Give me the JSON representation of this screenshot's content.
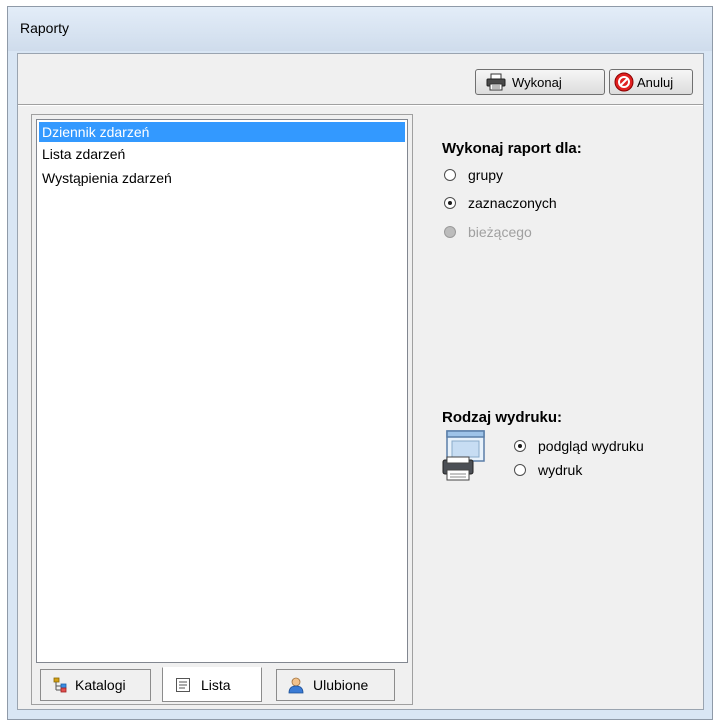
{
  "window": {
    "title": "Raporty"
  },
  "toolbar": {
    "execute_label": "Wykonaj",
    "cancel_label": "Anuluj"
  },
  "list": {
    "items": [
      {
        "label": "Dziennik zdarzeń",
        "selected": true
      },
      {
        "label": "Lista zdarzeń",
        "selected": false
      },
      {
        "label": "Wystąpienia zdarzeń",
        "selected": false
      }
    ]
  },
  "tabs": [
    {
      "label": "Katalogi",
      "icon": "catalog-tree-icon",
      "active": false
    },
    {
      "label": "Lista",
      "icon": "list-icon",
      "active": true
    },
    {
      "label": "Ulubione",
      "icon": "user-favorites-icon",
      "active": false
    }
  ],
  "report_target": {
    "heading": "Wykonaj raport dla:",
    "options": [
      {
        "label": "grupy",
        "checked": false,
        "disabled": false
      },
      {
        "label": "zaznaczonych",
        "checked": true,
        "disabled": false
      },
      {
        "label": "bieżącego",
        "checked": false,
        "disabled": true
      }
    ]
  },
  "print_type": {
    "heading": "Rodzaj wydruku:",
    "icon": "printer-preview-icon",
    "options": [
      {
        "label": "podgląd wydruku",
        "checked": true
      },
      {
        "label": "wydruk",
        "checked": false
      }
    ]
  },
  "colors": {
    "selection": "#3399ff",
    "cancel_icon": "#e02020"
  }
}
